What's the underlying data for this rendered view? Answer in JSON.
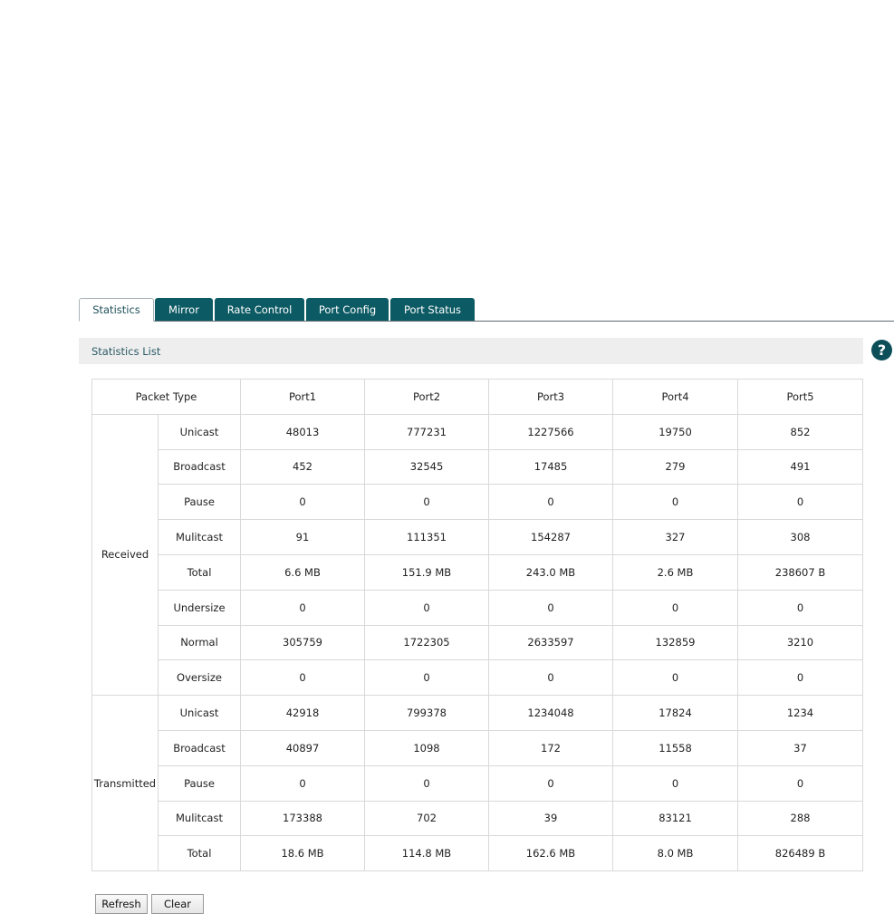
{
  "tabs": [
    {
      "label": "Statistics",
      "active": true
    },
    {
      "label": "Mirror",
      "active": false
    },
    {
      "label": "Rate Control",
      "active": false
    },
    {
      "label": "Port Config",
      "active": false
    },
    {
      "label": "Port Status",
      "active": false
    }
  ],
  "section": {
    "title": "Statistics List",
    "help_icon": "question-icon"
  },
  "table": {
    "headers": [
      "Packet Type",
      "Port1",
      "Port2",
      "Port3",
      "Port4",
      "Port5"
    ],
    "groups": [
      {
        "label": "Received",
        "rows": [
          {
            "type": "Unicast",
            "values": [
              "48013",
              "777231",
              "1227566",
              "19750",
              "852"
            ]
          },
          {
            "type": "Broadcast",
            "values": [
              "452",
              "32545",
              "17485",
              "279",
              "491"
            ]
          },
          {
            "type": "Pause",
            "values": [
              "0",
              "0",
              "0",
              "0",
              "0"
            ]
          },
          {
            "type": "Mulitcast",
            "values": [
              "91",
              "111351",
              "154287",
              "327",
              "308"
            ]
          },
          {
            "type": "Total",
            "values": [
              "6.6 MB",
              "151.9 MB",
              "243.0 MB",
              "2.6 MB",
              "238607 B"
            ]
          },
          {
            "type": "Undersize",
            "values": [
              "0",
              "0",
              "0",
              "0",
              "0"
            ]
          },
          {
            "type": "Normal",
            "values": [
              "305759",
              "1722305",
              "2633597",
              "132859",
              "3210"
            ]
          },
          {
            "type": "Oversize",
            "values": [
              "0",
              "0",
              "0",
              "0",
              "0"
            ]
          }
        ]
      },
      {
        "label": "Transmitted",
        "rows": [
          {
            "type": "Unicast",
            "values": [
              "42918",
              "799378",
              "1234048",
              "17824",
              "1234"
            ]
          },
          {
            "type": "Broadcast",
            "values": [
              "40897",
              "1098",
              "172",
              "11558",
              "37"
            ]
          },
          {
            "type": "Pause",
            "values": [
              "0",
              "0",
              "0",
              "0",
              "0"
            ]
          },
          {
            "type": "Mulitcast",
            "values": [
              "173388",
              "702",
              "39",
              "83121",
              "288"
            ]
          },
          {
            "type": "Total",
            "values": [
              "18.6 MB",
              "114.8 MB",
              "162.6 MB",
              "8.0 MB",
              "826489 B"
            ]
          }
        ]
      }
    ]
  },
  "buttons": {
    "refresh": "Refresh",
    "clear": "Clear"
  },
  "colors": {
    "tab_bg": "#0c5a64",
    "help_icon_bg": "#0c4f59",
    "header_bg": "#eeeeee"
  }
}
